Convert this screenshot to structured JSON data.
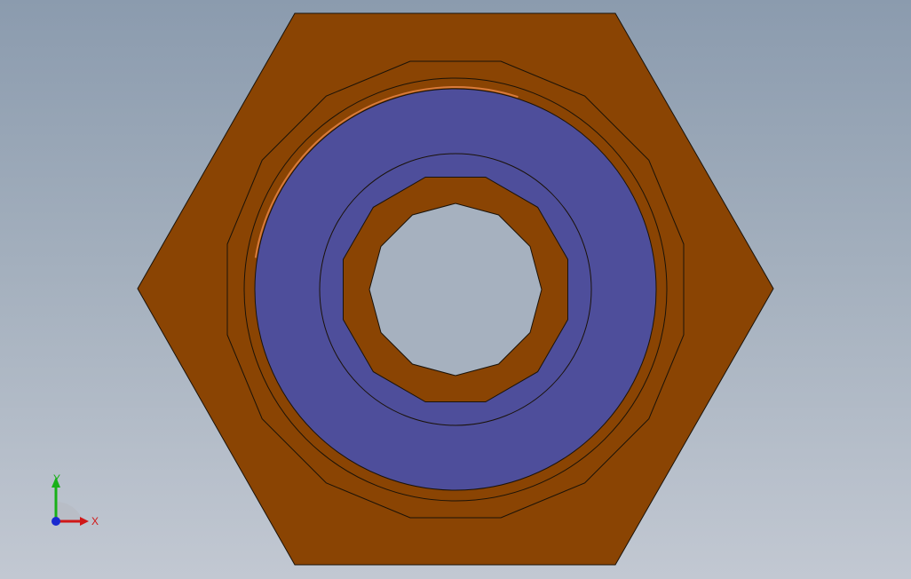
{
  "viewport": {
    "colors": {
      "part": "#8a4403",
      "face": "#4e4e9b",
      "edge": "#1a1208",
      "highlight": "#d87a3a"
    }
  },
  "triad": {
    "x_label": "X",
    "y_label": "Y",
    "colors": {
      "x": "#d01818",
      "y": "#18b018",
      "z": "#1a2ad0"
    }
  }
}
